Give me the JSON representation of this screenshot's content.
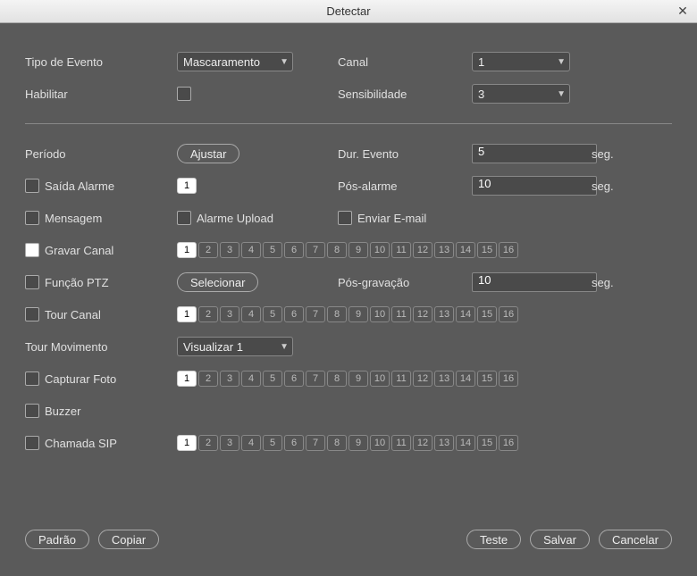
{
  "window": {
    "title": "Detectar"
  },
  "top": {
    "eventType": {
      "label": "Tipo de Evento",
      "value": "Mascaramento"
    },
    "enable": {
      "label": "Habilitar",
      "checked": false
    },
    "channel": {
      "label": "Canal",
      "value": "1"
    },
    "sensitivity": {
      "label": "Sensibilidade",
      "value": "3"
    }
  },
  "period": {
    "label": "Período",
    "button": "Ajustar"
  },
  "duration": {
    "label": "Dur. Evento",
    "value": "5",
    "suffix": "seg."
  },
  "alarmOut": {
    "label": "Saída Alarme",
    "checked": false,
    "channels": [
      true
    ],
    "channelCount": 1
  },
  "postAlarm": {
    "label": "Pós-alarme",
    "value": "10",
    "suffix": "seg."
  },
  "message": {
    "label": "Mensagem",
    "checked": false
  },
  "alarmUpload": {
    "label": "Alarme Upload",
    "checked": false
  },
  "sendEmail": {
    "label": "Enviar E-mail",
    "checked": false
  },
  "recordCh": {
    "label": "Gravar Canal",
    "checked": true,
    "channels": [
      true,
      false,
      false,
      false,
      false,
      false,
      false,
      false,
      false,
      false,
      false,
      false,
      false,
      false,
      false,
      false
    ]
  },
  "ptz": {
    "label": "Função PTZ",
    "checked": false,
    "button": "Selecionar"
  },
  "postRecord": {
    "label": "Pós-gravação",
    "value": "10",
    "suffix": "seg."
  },
  "tourCh": {
    "label": "Tour Canal",
    "checked": false,
    "channels": [
      true,
      false,
      false,
      false,
      false,
      false,
      false,
      false,
      false,
      false,
      false,
      false,
      false,
      false,
      false,
      false
    ]
  },
  "tourMotion": {
    "label": "Tour Movimento",
    "value": "Visualizar 1"
  },
  "snapshot": {
    "label": "Capturar Foto",
    "checked": false,
    "channels": [
      true,
      false,
      false,
      false,
      false,
      false,
      false,
      false,
      false,
      false,
      false,
      false,
      false,
      false,
      false,
      false
    ]
  },
  "buzzer": {
    "label": "Buzzer",
    "checked": false
  },
  "sipCall": {
    "label": "Chamada SIP",
    "checked": false,
    "channels": [
      true,
      false,
      false,
      false,
      false,
      false,
      false,
      false,
      false,
      false,
      false,
      false,
      false,
      false,
      false,
      false
    ]
  },
  "buttons": {
    "default": "Padrão",
    "copy": "Copiar",
    "test": "Teste",
    "save": "Salvar",
    "cancel": "Cancelar"
  }
}
